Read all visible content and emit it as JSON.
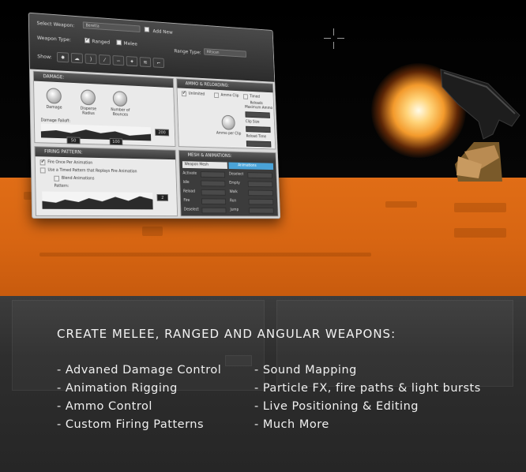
{
  "editor": {
    "select_weapon_label": "Select Weapon:",
    "select_weapon_value": "Beretta",
    "add_new_label": "Add New",
    "weapon_type_label": "Weapon Type:",
    "type_ranged_label": "Ranged",
    "type_melee_label": "Melee",
    "range_type_label": "Range Type:",
    "range_type_value": "Hitscan",
    "show_label": "Show:",
    "show_buttons": [
      "explosion-icon",
      "mushroom-cloud-icon",
      "sound-wave-icon",
      "path-icon",
      "curve-icon",
      "spark-icon",
      "fire-path-icon",
      "pistol-icon"
    ],
    "damage": {
      "title": "DAMAGE:",
      "knobs": [
        "Damage",
        "Disperse Radius",
        "Number of Bounces"
      ],
      "falloff_label": "Damage Falloff:",
      "falloff_max": "200",
      "falloff_mid": "50",
      "falloff_val": "100"
    },
    "ammo": {
      "title": "AMMO & RELOADING:",
      "options": [
        "Unlimited",
        "Ammo Clip",
        "Timed Reloads"
      ],
      "fields": [
        "Maximum Ammo",
        "Clip Size",
        "Reload Time"
      ],
      "per_clip_label": "Ammo per Clip"
    },
    "firing": {
      "title": "FIRING PATTERN:",
      "opt1": "Fire Once Per Animation",
      "opt2": "Use a Timed Pattern that Replays Fire Animation",
      "opt3": "Blend Animations",
      "pattern_label": "Pattern:",
      "pattern_value": "2"
    },
    "mesh": {
      "title": "MESH & ANIMATIONS:",
      "tab_mesh": "Weapon Mesh",
      "tab_anim": "Animations",
      "rows_left": [
        "Activate",
        "Idle",
        "Reload",
        "Fire",
        "Deselect"
      ],
      "rows_right": [
        "Deselect",
        "Empty",
        "Walk",
        "Run",
        "Jump"
      ]
    }
  },
  "headline": "CREATE MELEE, RANGED AND ANGULAR WEAPONS:",
  "features_left": [
    "- Advaned Damage Control",
    "- Animation Rigging",
    "- Ammo Control",
    "- Custom Firing Patterns"
  ],
  "features_right": [
    "- Sound Mapping",
    "- Particle FX, fire paths & light bursts",
    "- Live Positioning & Editing",
    "- Much More"
  ],
  "colors": {
    "orange_band": "#e06d16",
    "dark_band": "#2e2e2e",
    "text": "#f0f0f0",
    "flash": "#ffd47a",
    "accent_tab": "#4aa3d8"
  }
}
